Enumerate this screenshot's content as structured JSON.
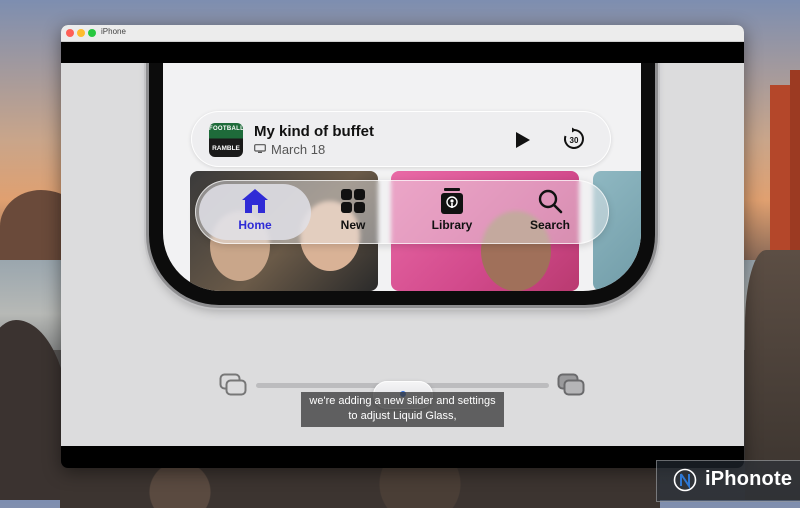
{
  "window": {
    "title": "iPhone"
  },
  "now_playing": {
    "title": "My kind of buffet",
    "subtitle": "March 18",
    "artwork_text_top": "FOOTBALL",
    "artwork_text_bottom": "RAMBLE",
    "icons": [
      "tv-icon",
      "play-icon",
      "skip-forward-30-icon"
    ],
    "skip_label": "30"
  },
  "tabbar": {
    "selected": "Home",
    "accent_color": "#2f2bd6",
    "tabs": [
      {
        "label": "Home",
        "icon": "house-icon"
      },
      {
        "label": "New",
        "icon": "grid-icon"
      },
      {
        "label": "Library",
        "icon": "podcast-library-icon"
      },
      {
        "label": "Search",
        "icon": "magnifier-icon"
      }
    ]
  },
  "slider": {
    "left_icon": "glass-clear-icon",
    "right_icon": "glass-tinted-icon",
    "value": 0.5
  },
  "caption": {
    "line1": "we're adding a new slider and settings",
    "line2": "to adjust Liquid Glass,"
  },
  "watermark": {
    "text": "iPhonote"
  }
}
